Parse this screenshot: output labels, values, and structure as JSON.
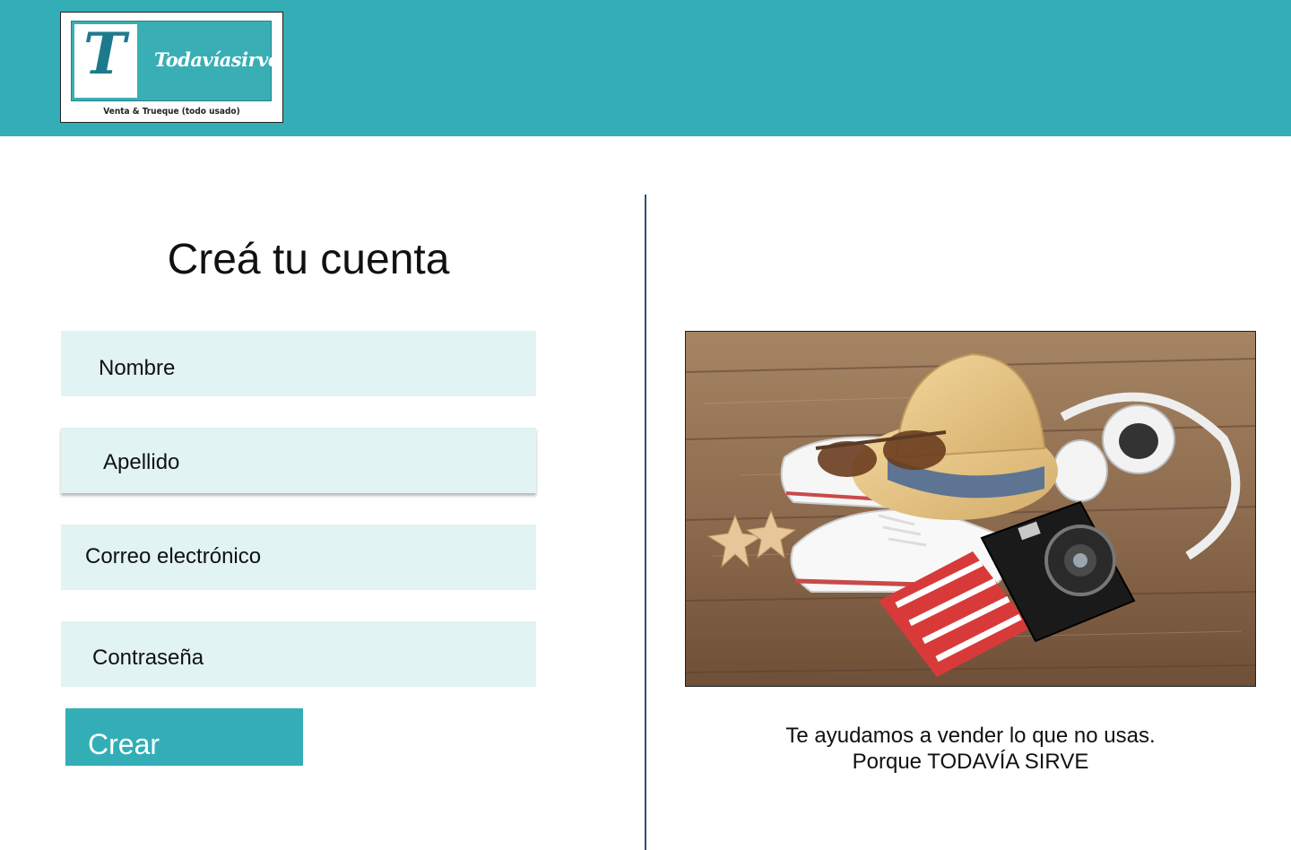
{
  "header": {
    "logo": {
      "letter": "T",
      "name": "Todavíasirve",
      "tagline": "Venta & Trueque (todo usado)"
    },
    "background_color": "#33aeb6"
  },
  "form": {
    "title": "Creá tu cuenta",
    "fields": {
      "nombre": "Nombre",
      "apellido": "Apellido",
      "correo": "Correo electrónico",
      "password": "Contraseña"
    },
    "submit_label": "Crear",
    "field_color": "#e1f3f3",
    "button_color": "#33aeb6"
  },
  "promo": {
    "image": "travel-items-photo",
    "caption_line1": "Te ayudamos a vender lo que no usas.",
    "caption_line2": "Porque TODAVÍA SIRVE"
  }
}
